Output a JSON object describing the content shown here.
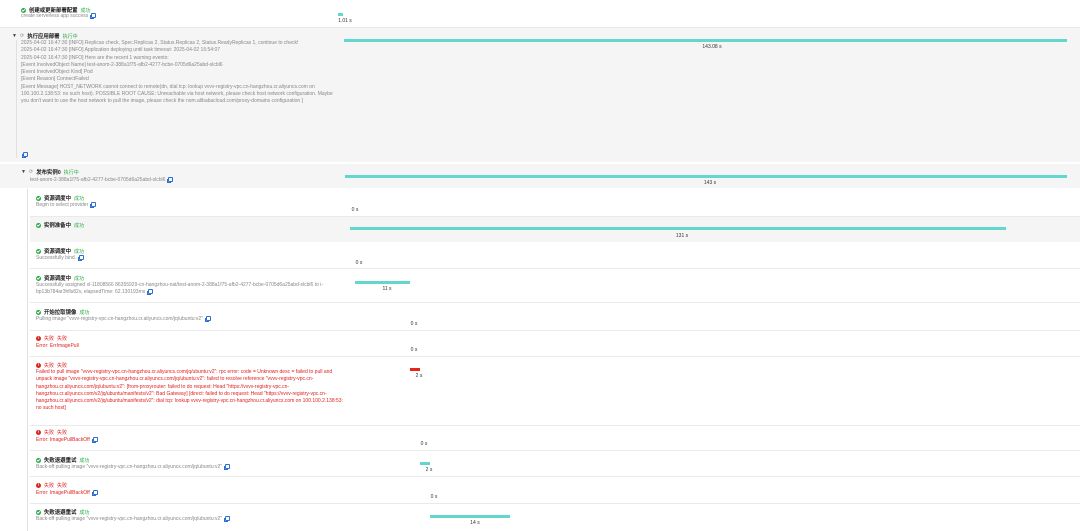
{
  "colors": {
    "accent": "#63d6cf",
    "success": "#2eab49",
    "error": "#e02020",
    "failbar": "#e5271b"
  },
  "steps": [
    {
      "title": "创建或更新部署配置",
      "status": "成功",
      "message": "create serverless app success",
      "duration": "1.01 s"
    },
    {
      "title": "执行应用部署",
      "status": "执行中",
      "duration": "143.08 s",
      "log": [
        "2025-04-02 16:47:30 [INFO] Replicas check, Spec.Replicas 2, Status.Replicas 2, Status.ReadyReplicas 1, continue to check!",
        "2025-04-02 16:47:30 [INFO] Application deploying until task timeout: 2025-04-02 16:54:07",
        "2025-04-02 16:47:30 [INFO] Here are the recent 1 warning events:",
        "[Event InvolvedObject Name] test-anom-2-388a1f75-afb2-4277-bcbe-0705d6a25abd-slcbl6",
        "[Event InvolvedObject Kind] Pod",
        "[Event Reason] ConnectFailed",
        "[Event Message] HOST_NETWORK cannot connect to remote(dn, dial tcp: lookup vvvv-registry-vpc.cn-hangzhou.cr.aliyuncs.com on 100.100.2.138:53: no such host). POSSIBLE ROOT CAUSE: Unreachable via host network, please check host network configuration. Maybe you don't want to use the host network to pull the image, please check the nom.alibabacloud.com/proxy-domains configuration ]"
      ]
    },
    {
      "title": "发布实例0",
      "status": "执行中",
      "message": "test-anom-2-388a1f75-afb2-4277-bcbe-0705d6a25abd-slcbl6",
      "duration": "143 s"
    }
  ],
  "events": [
    {
      "title": "资源调度中",
      "status": "成功",
      "message": "Begin to select provider",
      "duration": "0 s"
    },
    {
      "title": "实例准备中",
      "status": "成功",
      "message": "",
      "duration": "131 s"
    },
    {
      "title": "资源调度中",
      "status": "成功",
      "message": "Successfully bind.",
      "duration": "0 s"
    },
    {
      "title": "资源调度中",
      "status": "成功",
      "message": "Successfully assigned xl-11808566 86355929-cn-hangzhou-nat/test-anom-2-388a1f75-afb2-4277-bcbe-0705d6a25abd-slcbl6 to i-bp13b784ar3hfls82v, elapsedTime: 62.130193ms",
      "duration": "11 s"
    },
    {
      "title": "开始拉取镜像",
      "status": "成功",
      "message": "Pulling image \"vvvv-registry-vpc.cn-hangzhou.cr.aliyuncs.com/jq/ubuntu:v2\"",
      "duration": "0 s"
    },
    {
      "title": "失败",
      "status": "失败",
      "message": "Error: ErrImagePull",
      "duration": "0 s"
    },
    {
      "title": "失败",
      "status": "失败",
      "message": "Failed to pull image \"vvvv-registry-vpc.cn-hangzhou.cr.aliyuncs.com/jq/ubuntu:v2\": rpc error: code = Unknown desc = failed to pull and unpack image \"vvvv-registry-vpc.cn-hangzhou.cr.aliyuncs.com/jq/ubuntu:v2\": failed to resolve reference \"vvvv-registry-vpc.cn-hangzhou.cr.aliyuncs.com/jq/ubuntu:v2\": [from-proxyrouter: failed to do request: Head \"https://vvvv-registry-vpc.cn-hangzhou.cr.aliyuncs.com/v2/jq/ubuntu/manifests/v2\": Bad Gateway] [direct: failed to do request: Head \"https://vvvv-registry-vpc.cn-hangzhou.cr.aliyuncs.com/v2/jq/ubuntu/manifests/v2\": dial tcp: lookup vvvv-registry-vpc.cn-hangzhou.cr.aliyuncs.com on 100.100.2.138:53: no such host]",
      "duration": "2 s"
    },
    {
      "title": "失败",
      "status": "失败",
      "message": "Error: ImagePullBackOff",
      "duration": "0 s"
    },
    {
      "title": "失败退避重试",
      "status": "成功",
      "message": "Back-off pulling image \"vvvv-registry-vpc.cn-hangzhou.cr.aliyuncs.com/jq/ubuntu:v2\"",
      "duration": "2 s"
    },
    {
      "title": "失败",
      "status": "失败",
      "message": "Error: ImagePullBackOff",
      "duration": "0 s"
    },
    {
      "title": "失败退避重试",
      "status": "成功",
      "message": "Back-off pulling image \"vvvv-registry-vpc.cn-hangzhou.cr.aliyuncs.com/jq/ubuntu:v2\"",
      "duration": "14 s"
    }
  ]
}
